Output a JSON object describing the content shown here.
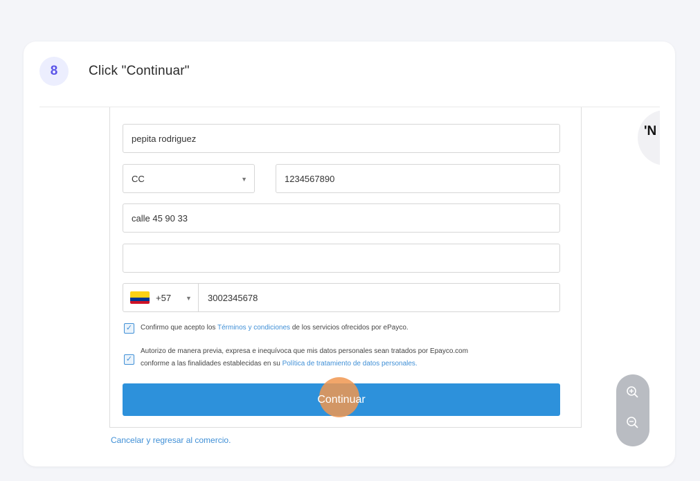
{
  "step": {
    "number": "8",
    "title": "Click \"Continuar\""
  },
  "form": {
    "name_value": "pepita rodriguez",
    "doc_type": "CC",
    "doc_number": "1234567890",
    "address": "calle 45 90 33",
    "email": "",
    "phone_code": "+57",
    "phone_number": "3002345678",
    "terms": {
      "prefix": "Confirmo que acepto los ",
      "link": "Términos y condiciones",
      "suffix": " de los servicios ofrecidos por ePayco."
    },
    "privacy": {
      "line1": "Autorizo de manera previa, expresa e inequívoca que mis datos personales sean tratados por Epayco.com",
      "line2_prefix": "conforme a las finalidades establecidas en su ",
      "link": "Política de tratamiento de datos personales."
    },
    "continue_label": "Continuar",
    "cancel_label": "Cancelar y regresar al comercio."
  },
  "brand": {
    "text": "'N"
  },
  "icons": {
    "dropdown": "chevron-down-icon",
    "checkbox": "check-icon",
    "zoom_in": "zoom-in-icon",
    "zoom_out": "zoom-out-icon",
    "flag": "colombia-flag-icon"
  },
  "colors": {
    "accent": "#2d91db",
    "badge": "#5b54e8",
    "click_marker": "#f0964f"
  }
}
